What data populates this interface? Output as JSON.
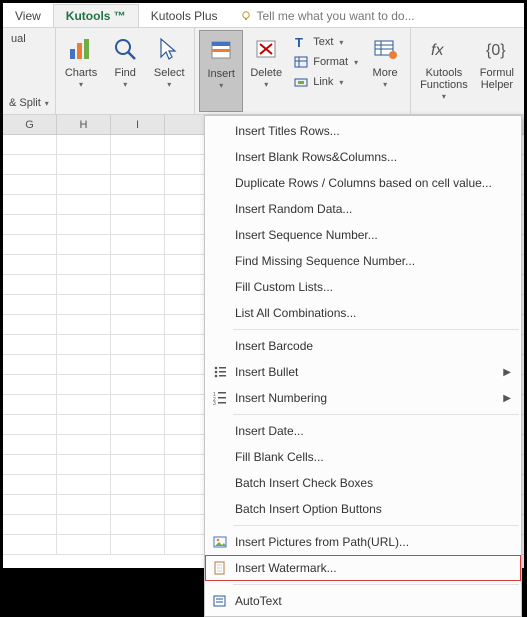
{
  "tabs": {
    "view": "View",
    "kutools": "Kutools ™",
    "kutools_plus": "Kutools Plus",
    "tell_me": "Tell me what you want to do..."
  },
  "ribbon": {
    "ual": "ual",
    "split": "& Split",
    "charts": "Charts",
    "find": "Find",
    "select": "Select",
    "insert": "Insert",
    "delete": "Delete",
    "text": "Text",
    "format": "Format",
    "link": "Link",
    "more": "More",
    "kutools_fn": "Kutools\nFunctions",
    "formula_helper": "Formul\nHelper"
  },
  "columns": [
    "G",
    "H",
    "I"
  ],
  "menu": {
    "titles_rows": "Insert Titles Rows...",
    "blank_rc": "Insert Blank Rows&Columns...",
    "dup_rows": "Duplicate Rows / Columns based on cell value...",
    "random": "Insert Random Data...",
    "seq_num": "Insert Sequence Number...",
    "missing_seq": "Find Missing Sequence Number...",
    "fill_lists": "Fill Custom Lists...",
    "list_comb": "List All Combinations...",
    "barcode": "Insert Barcode",
    "bullet": "Insert Bullet",
    "numbering": "Insert Numbering",
    "date": "Insert Date...",
    "fill_blank": "Fill Blank Cells...",
    "check_boxes": "Batch Insert Check Boxes",
    "option_btns": "Batch Insert Option Buttons",
    "pictures": "Insert Pictures from Path(URL)...",
    "watermark": "Insert Watermark...",
    "autotext": "AutoText"
  }
}
